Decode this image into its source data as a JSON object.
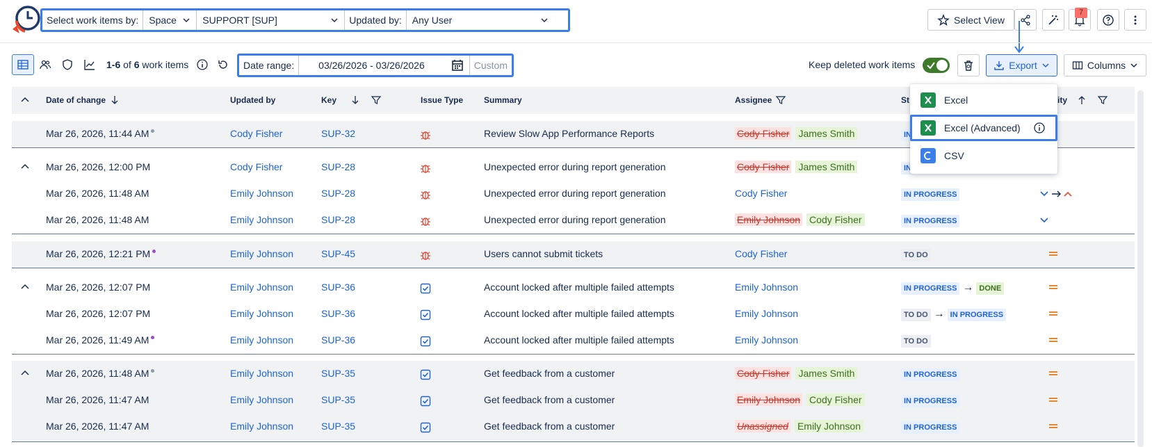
{
  "filters": {
    "select_by_label": "Select work items by:",
    "select_by_value": "Space",
    "space_value": "SUPPORT [SUP]",
    "updated_by_label": "Updated by:",
    "updated_by_value": "Any User"
  },
  "header": {
    "select_view_label": "Select View",
    "notification_count": "7"
  },
  "toolbar": {
    "count_range": "1-6",
    "count_of": "of",
    "count_total": "6",
    "count_suffix": "work items",
    "date_range_label": "Date range:",
    "date_range_value": "03/26/2026 - 03/26/2026",
    "date_range_custom": "Custom",
    "keep_deleted_label": "Keep deleted work items",
    "keep_deleted_on": true,
    "export_label": "Export",
    "columns_label": "Columns"
  },
  "columns": {
    "date": "Date of change",
    "updated_by": "Updated by",
    "key": "Key",
    "issue_type": "Issue Type",
    "summary": "Summary",
    "assignee": "Assignee",
    "status": "St",
    "priority": "ity"
  },
  "export_menu": {
    "items": [
      {
        "label": "Excel",
        "icon": "excel-icon"
      },
      {
        "label": "Excel (Advanced)",
        "icon": "excel-icon"
      },
      {
        "label": "CSV",
        "icon": "csv-icon"
      }
    ]
  },
  "rows": [
    {
      "date": "Mar 26, 2026, 11:44 AM",
      "updated_by": "Cody Fisher",
      "key": "SUP-32",
      "type": "bug",
      "summary": "Review Slow App Performance Reports",
      "assignee_old": "Cody Fisher",
      "assignee_new": "James Smith",
      "status": [
        "IN"
      ]
    },
    {
      "date": "Mar 26, 2026, 12:00 PM",
      "updated_by": "Cody Fisher",
      "key": "SUP-28",
      "type": "bug",
      "summary": "Unexpected error during report generation",
      "assignee_old": "Cody Fisher",
      "assignee_new": "James Smith",
      "status": [
        "IN"
      ]
    },
    {
      "date": "Mar 26, 2026, 11:48 AM",
      "updated_by": "Emily Johnson",
      "key": "SUP-28",
      "type": "bug",
      "summary": "Unexpected error during report generation",
      "assignee": "Cody Fisher",
      "status": [
        "IN PROGRESS"
      ]
    },
    {
      "date": "Mar 26, 2026, 11:48 AM",
      "updated_by": "Emily Johnson",
      "key": "SUP-28",
      "type": "bug",
      "summary": "Unexpected error during report generation",
      "assignee_old": "Emily Johnson",
      "assignee_new": "Cody Fisher",
      "status": [
        "IN PROGRESS"
      ]
    },
    {
      "date": "Mar 26, 2026, 12:21 PM",
      "updated_by": "Emily Johnson",
      "key": "SUP-45",
      "type": "bug",
      "summary": "Users cannot submit tickets",
      "assignee": "Cody Fisher",
      "status": [
        "TO DO"
      ]
    },
    {
      "date": "Mar 26, 2026, 12:07 PM",
      "updated_by": "Emily Johnson",
      "key": "SUP-36",
      "type": "task",
      "summary": "Account locked after multiple failed attempts",
      "assignee": "Emily Johnson",
      "status": [
        "IN PROGRESS",
        "DONE"
      ]
    },
    {
      "date": "Mar 26, 2026, 12:07 PM",
      "updated_by": "Emily Johnson",
      "key": "SUP-36",
      "type": "task",
      "summary": "Account locked after multiple failed attempts",
      "assignee": "Emily Johnson",
      "status": [
        "TO DO",
        "IN PROGRESS"
      ]
    },
    {
      "date": "Mar 26, 2026, 11:49 AM",
      "updated_by": "Emily Johnson",
      "key": "SUP-36",
      "type": "task",
      "summary": "Account locked after multiple failed attempts",
      "assignee": "Emily Johnson",
      "status": [
        "TO DO"
      ]
    },
    {
      "date": "Mar 26, 2026, 11:48 AM",
      "updated_by": "Emily Johnson",
      "key": "SUP-35",
      "type": "task",
      "summary": "Get feedback from a customer",
      "assignee_old": "Cody Fisher",
      "assignee_new": "James Smith",
      "status": [
        "IN PROGRESS"
      ]
    },
    {
      "date": "Mar 26, 2026, 11:47 AM",
      "updated_by": "Emily Johnson",
      "key": "SUP-35",
      "type": "task",
      "summary": "Get feedback from a customer",
      "assignee_old": "Emily Johnson",
      "assignee_new": "Cody Fisher",
      "status": [
        "IN PROGRESS"
      ]
    },
    {
      "date": "Mar 26, 2026, 11:47 AM",
      "updated_by": "Emily Johnson",
      "key": "SUP-35",
      "type": "task",
      "summary": "Get feedback from a customer",
      "assignee_old": "Unassigned",
      "assignee_new": "Emily Johnson",
      "status": [
        "IN PROGRESS"
      ]
    }
  ]
}
